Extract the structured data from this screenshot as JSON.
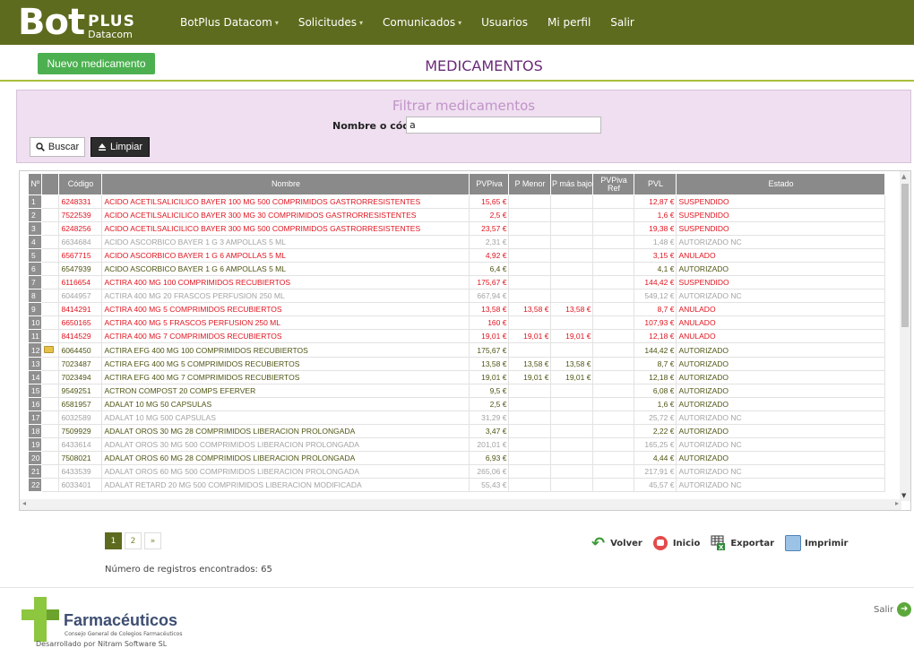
{
  "header": {
    "logo_main": "Bot",
    "logo_plus": "PLUS",
    "logo_sub": "Datacom",
    "menu": [
      {
        "label": "BotPlus Datacom",
        "dropdown": true
      },
      {
        "label": "Solicitudes",
        "dropdown": true
      },
      {
        "label": "Comunicados",
        "dropdown": true
      },
      {
        "label": "Usuarios",
        "dropdown": false
      },
      {
        "label": "Mi perfil",
        "dropdown": false
      },
      {
        "label": "Salir",
        "dropdown": false
      }
    ]
  },
  "toolbar": {
    "new_button": "Nuevo medicamento",
    "page_title": "MEDICAMENTOS"
  },
  "filter": {
    "title": "Filtrar medicamentos",
    "label": "Nombre o código",
    "value": "a",
    "search_button": "Buscar",
    "clear_button": "Limpiar"
  },
  "table": {
    "columns": [
      "Nº",
      "",
      "Código",
      "Nombre",
      "PVPiva",
      "P Menor",
      "P más bajo",
      "PVPiva Ref",
      "PVL",
      "Estado"
    ],
    "rows": [
      {
        "n": "1",
        "folder": false,
        "code": "6248331",
        "name": "ACIDO ACETILSALICILICO BAYER 100 MG 500 COMPRIMIDOS GASTRORRESISTENTES",
        "pvp": "15,65 €",
        "pmenor": "",
        "pbajo": "",
        "ref": "",
        "pvl": "12,87 €",
        "estado": "SUSPENDIDO",
        "color": "red"
      },
      {
        "n": "2",
        "folder": false,
        "code": "7522539",
        "name": "ACIDO ACETILSALICILICO BAYER 300 MG 30 COMPRIMIDOS GASTRORRESISTENTES",
        "pvp": "2,5 €",
        "pmenor": "",
        "pbajo": "",
        "ref": "",
        "pvl": "1,6 €",
        "estado": "SUSPENDIDO",
        "color": "red"
      },
      {
        "n": "3",
        "folder": false,
        "code": "6248256",
        "name": "ACIDO ACETILSALICILICO BAYER 300 MG 500 COMPRIMIDOS GASTRORRESISTENTES",
        "pvp": "23,57 €",
        "pmenor": "",
        "pbajo": "",
        "ref": "",
        "pvl": "19,38 €",
        "estado": "SUSPENDIDO",
        "color": "red"
      },
      {
        "n": "4",
        "folder": false,
        "code": "6634684",
        "name": "ACIDO ASCORBICO BAYER 1 G 3 AMPOLLAS 5 ML",
        "pvp": "2,31 €",
        "pmenor": "",
        "pbajo": "",
        "ref": "",
        "pvl": "1,48 €",
        "estado": "AUTORIZADO NC",
        "color": "grey"
      },
      {
        "n": "5",
        "folder": false,
        "code": "6567715",
        "name": "ACIDO ASCORBICO BAYER 1 G 6 AMPOLLAS 5 ML",
        "pvp": "4,92 €",
        "pmenor": "",
        "pbajo": "",
        "ref": "",
        "pvl": "3,15 €",
        "estado": "ANULADO",
        "color": "red"
      },
      {
        "n": "6",
        "folder": false,
        "code": "6547939",
        "name": "ACIDO ASCORBICO BAYER 1 G 6 AMPOLLAS 5 ML",
        "pvp": "6,4 €",
        "pmenor": "",
        "pbajo": "",
        "ref": "",
        "pvl": "4,1 €",
        "estado": "AUTORIZADO",
        "color": "olive"
      },
      {
        "n": "7",
        "folder": false,
        "code": "6116654",
        "name": "ACTIRA 400 MG 100 COMPRIMIDOS RECUBIERTOS",
        "pvp": "175,67 €",
        "pmenor": "",
        "pbajo": "",
        "ref": "",
        "pvl": "144,42 €",
        "estado": "SUSPENDIDO",
        "color": "red"
      },
      {
        "n": "8",
        "folder": false,
        "code": "6044957",
        "name": "ACTIRA 400 MG 20 FRASCOS PERFUSION 250 ML",
        "pvp": "667,94 €",
        "pmenor": "",
        "pbajo": "",
        "ref": "",
        "pvl": "549,12 €",
        "estado": "AUTORIZADO NC",
        "color": "grey"
      },
      {
        "n": "9",
        "folder": false,
        "code": "8414291",
        "name": "ACTIRA 400 MG 5 COMPRIMIDOS RECUBIERTOS",
        "pvp": "13,58 €",
        "pmenor": "13,58 €",
        "pbajo": "13,58 €",
        "ref": "",
        "pvl": "8,7 €",
        "estado": "ANULADO",
        "color": "red"
      },
      {
        "n": "10",
        "folder": false,
        "code": "6650165",
        "name": "ACTIRA 400 MG 5 FRASCOS PERFUSION 250 ML",
        "pvp": "160 €",
        "pmenor": "",
        "pbajo": "",
        "ref": "",
        "pvl": "107,93 €",
        "estado": "ANULADO",
        "color": "red"
      },
      {
        "n": "11",
        "folder": false,
        "code": "8414529",
        "name": "ACTIRA 400 MG 7 COMPRIMIDOS RECUBIERTOS",
        "pvp": "19,01 €",
        "pmenor": "19,01 €",
        "pbajo": "19,01 €",
        "ref": "",
        "pvl": "12,18 €",
        "estado": "ANULADO",
        "color": "red"
      },
      {
        "n": "12",
        "folder": true,
        "code": "6064450",
        "name": "ACTIRA EFG 400 MG 100 COMPRIMIDOS RECUBIERTOS",
        "pvp": "175,67 €",
        "pmenor": "",
        "pbajo": "",
        "ref": "",
        "pvl": "144,42 €",
        "estado": "AUTORIZADO",
        "color": "olive"
      },
      {
        "n": "13",
        "folder": false,
        "code": "7023487",
        "name": "ACTIRA EFG 400 MG 5 COMPRIMIDOS RECUBIERTOS",
        "pvp": "13,58 €",
        "pmenor": "13,58 €",
        "pbajo": "13,58 €",
        "ref": "",
        "pvl": "8,7 €",
        "estado": "AUTORIZADO",
        "color": "olive"
      },
      {
        "n": "14",
        "folder": false,
        "code": "7023494",
        "name": "ACTIRA EFG 400 MG 7 COMPRIMIDOS RECUBIERTOS",
        "pvp": "19,01 €",
        "pmenor": "19,01 €",
        "pbajo": "19,01 €",
        "ref": "",
        "pvl": "12,18 €",
        "estado": "AUTORIZADO",
        "color": "olive"
      },
      {
        "n": "15",
        "folder": false,
        "code": "9549251",
        "name": "ACTRON COMPOST 20 COMPS EFERVER",
        "pvp": "9,5 €",
        "pmenor": "",
        "pbajo": "",
        "ref": "",
        "pvl": "6,08 €",
        "estado": "AUTORIZADO",
        "color": "olive"
      },
      {
        "n": "16",
        "folder": false,
        "code": "6581957",
        "name": "ADALAT 10 MG 50 CAPSULAS",
        "pvp": "2,5 €",
        "pmenor": "",
        "pbajo": "",
        "ref": "",
        "pvl": "1,6 €",
        "estado": "AUTORIZADO",
        "color": "olive"
      },
      {
        "n": "17",
        "folder": false,
        "code": "6032589",
        "name": "ADALAT 10 MG 500 CAPSULAS",
        "pvp": "31,29 €",
        "pmenor": "",
        "pbajo": "",
        "ref": "",
        "pvl": "25,72 €",
        "estado": "AUTORIZADO NC",
        "color": "grey"
      },
      {
        "n": "18",
        "folder": false,
        "code": "7509929",
        "name": "ADALAT OROS 30 MG 28 COMPRIMIDOS LIBERACION PROLONGADA",
        "pvp": "3,47 €",
        "pmenor": "",
        "pbajo": "",
        "ref": "",
        "pvl": "2,22 €",
        "estado": "AUTORIZADO",
        "color": "olive"
      },
      {
        "n": "19",
        "folder": false,
        "code": "6433614",
        "name": "ADALAT OROS 30 MG 500 COMPRIMIDOS LIBERACION PROLONGADA",
        "pvp": "201,01 €",
        "pmenor": "",
        "pbajo": "",
        "ref": "",
        "pvl": "165,25 €",
        "estado": "AUTORIZADO NC",
        "color": "grey"
      },
      {
        "n": "20",
        "folder": false,
        "code": "7508021",
        "name": "ADALAT OROS 60 MG 28 COMPRIMIDOS LIBERACION PROLONGADA",
        "pvp": "6,93 €",
        "pmenor": "",
        "pbajo": "",
        "ref": "",
        "pvl": "4,44 €",
        "estado": "AUTORIZADO",
        "color": "olive"
      },
      {
        "n": "21",
        "folder": false,
        "code": "6433539",
        "name": "ADALAT OROS 60 MG 500 COMPRIMIDOS LIBERACION PROLONGADA",
        "pvp": "265,06 €",
        "pmenor": "",
        "pbajo": "",
        "ref": "",
        "pvl": "217,91 €",
        "estado": "AUTORIZADO NC",
        "color": "grey"
      },
      {
        "n": "22",
        "folder": false,
        "code": "6033401",
        "name": "ADALAT RETARD 20 MG 500 COMPRIMIDOS LIBERACION MODIFICADA",
        "pvp": "55,43 €",
        "pmenor": "",
        "pbajo": "",
        "ref": "",
        "pvl": "45,57 €",
        "estado": "AUTORIZADO NC",
        "color": "grey"
      }
    ]
  },
  "pagination": {
    "pages": [
      "1",
      "2",
      "»"
    ],
    "current": "1",
    "count_text": "Número de registros encontrados: 65"
  },
  "actions": {
    "volver": "Volver",
    "inicio": "Inicio",
    "exportar": "Exportar",
    "imprimir": "Imprimir"
  },
  "footer": {
    "brand": "Farmacéuticos",
    "brand_sub": "Consejo General de Colegios Farmacéuticos",
    "developer": "Desarrollado por Nitram Software SL",
    "salir": "Salir"
  },
  "colors": {
    "topbar": "#5d6b1e",
    "accent_green": "#4cb050",
    "title_purple": "#6a2b78",
    "filter_bg": "#efdff0",
    "status_red": "#e0141f",
    "status_grey": "#a3a3a3",
    "status_olive": "#4f5513"
  },
  "icons": [
    "search-icon",
    "eject-icon",
    "folder-icon",
    "back-arrow-icon",
    "home-icon",
    "export-excel-icon",
    "print-icon",
    "exit-icon"
  ]
}
